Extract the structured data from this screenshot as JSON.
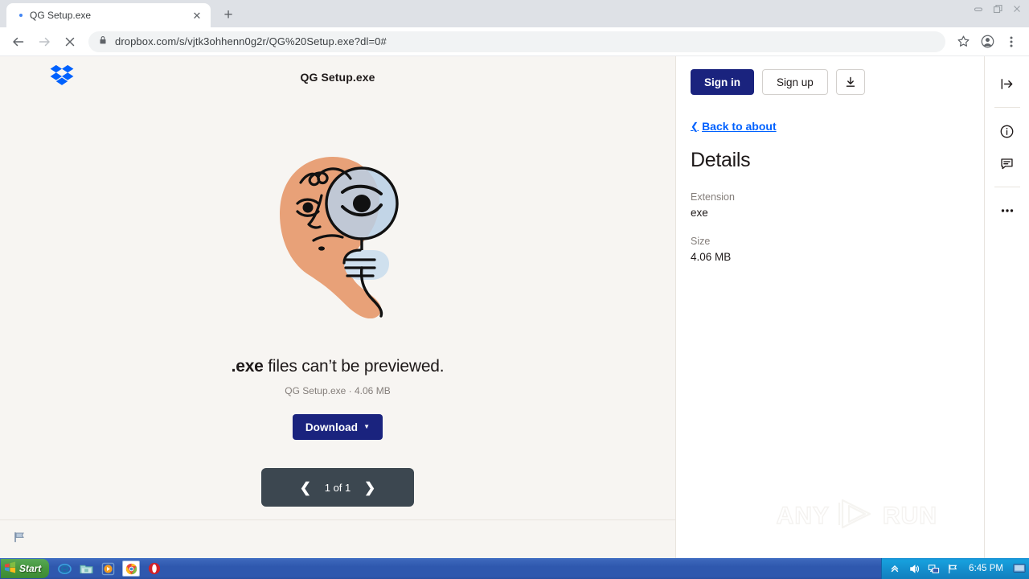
{
  "browser": {
    "tab": {
      "title": "QG Setup.exe",
      "spinner_icon": "loading-dot",
      "close_icon": "close-icon"
    },
    "newtab_icon": "plus-icon",
    "window_controls": {
      "minimize": "minimize-icon",
      "restore": "restore-icon",
      "close": "close-icon"
    },
    "nav": {
      "back_icon": "back-arrow-icon",
      "forward_icon": "forward-arrow-icon",
      "stop_icon": "stop-loading-icon"
    },
    "omnibox": {
      "lock_icon": "lock-icon",
      "url": "dropbox.com/s/vjtk3ohhenn0g2r/QG%20Setup.exe?dl=0#"
    },
    "toolbar_icons": {
      "bookmark": "star-icon",
      "profile": "account-avatar-icon",
      "menu": "three-dot-menu-icon"
    }
  },
  "page": {
    "logo_icon": "dropbox-logo-icon",
    "header_title": "QG Setup.exe",
    "illustration": "face-with-magnifying-glass-illustration",
    "message_prefix": ".exe",
    "message_rest": " files can’t be previewed.",
    "submessage": "QG Setup.exe · 4.06 MB",
    "download_button": "Download",
    "download_caret_icon": "chevron-down-icon",
    "pager": {
      "prev_icon": "chevron-left-icon",
      "next_icon": "chevron-right-icon",
      "count": "1 of 1"
    },
    "footer_flag_icon": "report-flag-icon",
    "watermark": {
      "left": "ANY",
      "right": "RUN",
      "logo_icon": "play-triangle-icon"
    }
  },
  "sidebar": {
    "sign_in": "Sign in",
    "sign_up": "Sign up",
    "download_icon": "download-arrow-icon",
    "back_link": "Back to about",
    "back_chevron_icon": "chevron-left-icon",
    "title": "Details",
    "fields": [
      {
        "label": "Extension",
        "value": "exe"
      },
      {
        "label": "Size",
        "value": "4.06 MB"
      }
    ]
  },
  "rail": {
    "collapse_icon": "collapse-panel-icon",
    "info_icon": "info-circle-icon",
    "comment_icon": "comment-bubble-icon",
    "more_icon": "three-dot-menu-icon"
  },
  "taskbar": {
    "start_label": "Start",
    "start_icon": "windows-flag-icon",
    "quicklaunch": [
      {
        "name": "internet-explorer-icon"
      },
      {
        "name": "folder-icon"
      },
      {
        "name": "media-player-icon"
      },
      {
        "name": "chrome-icon"
      },
      {
        "name": "opera-icon"
      }
    ],
    "tray": {
      "chevron_icon": "show-hidden-icons-icon",
      "volume_icon": "volume-icon",
      "network_icon": "network-icon",
      "security_icon": "security-flag-icon",
      "time": "6:45 PM",
      "desktop_icon": "show-desktop-icon"
    }
  },
  "colors": {
    "accent_navy": "#1a237e",
    "link_blue": "#0061fe",
    "page_bg": "#f7f5f2",
    "pager_bg": "#3c4750"
  }
}
